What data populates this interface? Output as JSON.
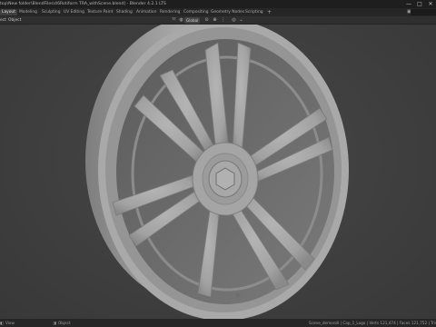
{
  "window": {
    "title": "top\\New folder\\BlendFiles\\46Rotiform TRA_withScene.blend] - Blender 4.2.1 LTS",
    "minimize_glyph": "—",
    "maximize_glyph": "□",
    "close_glyph": "✕"
  },
  "workspace_tabs": [
    {
      "label": "Layout",
      "active": true
    },
    {
      "label": "Modeling"
    },
    {
      "label": "Sculpting"
    },
    {
      "label": "UV Editing"
    },
    {
      "label": "Texture Paint"
    },
    {
      "label": "Shading"
    },
    {
      "label": "Animation"
    },
    {
      "label": "Rendering"
    },
    {
      "label": "Compositing"
    },
    {
      "label": "Geometry Nodes"
    },
    {
      "label": "Scripting"
    }
  ],
  "add_tab_glyph": "+",
  "header": {
    "view_menu": "ect",
    "object_menu": "Object",
    "transform_orientation": "Global",
    "transform_orientation_icon": "globe-icon"
  },
  "statusbar": {
    "left_text": "View",
    "left_icon": "mouse-icon",
    "middle_text": "Object",
    "stats": "Scene_demoroll | Cap_1_Logo | Verts 121,474 | Faces 121,752 | Tris 243,5"
  }
}
